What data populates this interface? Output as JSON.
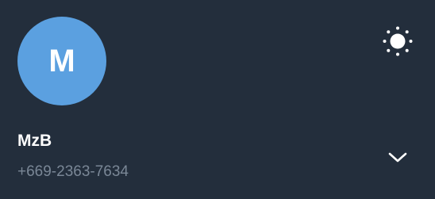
{
  "account": {
    "avatar_letter": "M",
    "name": "MzB",
    "phone": "+669-2363-7634"
  },
  "icons": {
    "theme_toggle": "sun-icon",
    "expand": "chevron-down-icon"
  },
  "colors": {
    "background": "#232e3c",
    "avatar": "#5ba0e0",
    "name_text": "#ffffff",
    "phone_text": "#7a8796",
    "icon": "#ffffff"
  }
}
